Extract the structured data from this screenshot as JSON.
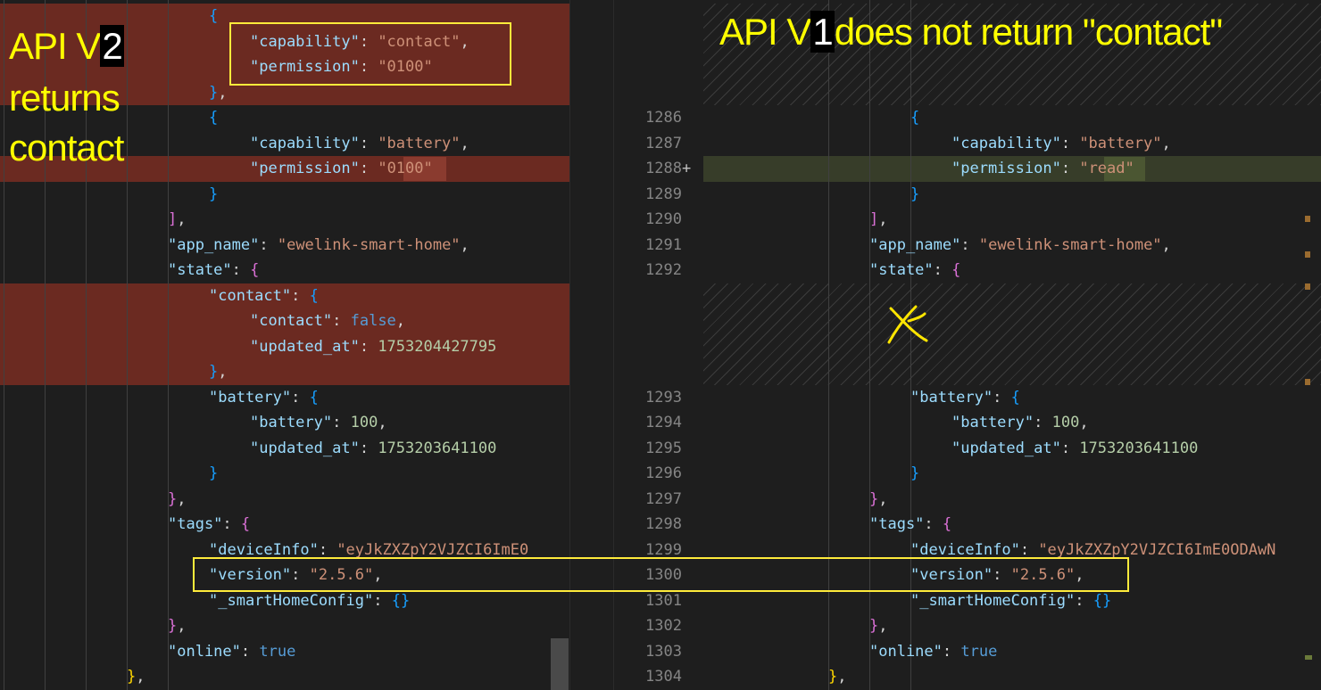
{
  "annotations": {
    "left_title_prefix": "API V",
    "left_title_digit": "2",
    "left_line2": "returns",
    "left_line3": "contact",
    "right_prefix": "API V",
    "right_digit": "1",
    "right_suffix": "does not return \"contact\""
  },
  "left_code": [
    {
      "parts": [
        {
          "t": "{",
          "c": "c"
        }
      ]
    },
    {
      "parts": [
        {
          "t": "\"capability\"",
          "c": "k"
        },
        {
          "t": ": ",
          "c": "p"
        },
        {
          "t": "\"contact\"",
          "c": "s"
        },
        {
          "t": ",",
          "c": "p"
        }
      ]
    },
    {
      "parts": [
        {
          "t": "\"permission\"",
          "c": "k"
        },
        {
          "t": ": ",
          "c": "p"
        },
        {
          "t": "\"0100\"",
          "c": "s"
        }
      ]
    },
    {
      "parts": [
        {
          "t": "}",
          "c": "c"
        },
        {
          "t": ",",
          "c": "p"
        }
      ]
    },
    {
      "parts": [
        {
          "t": "{",
          "c": "c"
        }
      ]
    },
    {
      "parts": [
        {
          "t": "\"capability\"",
          "c": "k"
        },
        {
          "t": ": ",
          "c": "p"
        },
        {
          "t": "\"battery\"",
          "c": "s"
        },
        {
          "t": ",",
          "c": "p"
        }
      ]
    },
    {
      "parts": [
        {
          "t": "\"permission\"",
          "c": "k"
        },
        {
          "t": ": ",
          "c": "p"
        },
        {
          "t": "\"",
          "c": "s"
        },
        {
          "t": "0100",
          "c": "s"
        },
        {
          "t": "\"",
          "c": "s"
        }
      ]
    },
    {
      "parts": [
        {
          "t": "}",
          "c": "c"
        }
      ]
    },
    {
      "parts": [
        {
          "t": "]",
          "c": "m"
        },
        {
          "t": ",",
          "c": "p"
        }
      ]
    },
    {
      "parts": [
        {
          "t": "\"app_name\"",
          "c": "k"
        },
        {
          "t": ": ",
          "c": "p"
        },
        {
          "t": "\"ewelink-smart-home\"",
          "c": "s"
        },
        {
          "t": ",",
          "c": "p"
        }
      ]
    },
    {
      "parts": [
        {
          "t": "\"state\"",
          "c": "k"
        },
        {
          "t": ": ",
          "c": "p"
        },
        {
          "t": "{",
          "c": "m"
        }
      ]
    },
    {
      "parts": [
        {
          "t": "\"contact\"",
          "c": "k"
        },
        {
          "t": ": ",
          "c": "p"
        },
        {
          "t": "{",
          "c": "c"
        }
      ]
    },
    {
      "parts": [
        {
          "t": "\"contact\"",
          "c": "k"
        },
        {
          "t": ": ",
          "c": "p"
        },
        {
          "t": "false",
          "c": "b"
        },
        {
          "t": ",",
          "c": "p"
        }
      ]
    },
    {
      "parts": [
        {
          "t": "\"updated_at\"",
          "c": "k"
        },
        {
          "t": ": ",
          "c": "p"
        },
        {
          "t": "1753204427795",
          "c": "n"
        }
      ]
    },
    {
      "parts": [
        {
          "t": "}",
          "c": "c"
        },
        {
          "t": ",",
          "c": "p"
        }
      ]
    },
    {
      "parts": [
        {
          "t": "\"battery\"",
          "c": "k"
        },
        {
          "t": ": ",
          "c": "p"
        },
        {
          "t": "{",
          "c": "c"
        }
      ]
    },
    {
      "parts": [
        {
          "t": "\"battery\"",
          "c": "k"
        },
        {
          "t": ": ",
          "c": "p"
        },
        {
          "t": "100",
          "c": "n"
        },
        {
          "t": ",",
          "c": "p"
        }
      ]
    },
    {
      "parts": [
        {
          "t": "\"updated_at\"",
          "c": "k"
        },
        {
          "t": ": ",
          "c": "p"
        },
        {
          "t": "1753203641100",
          "c": "n"
        }
      ]
    },
    {
      "parts": [
        {
          "t": "}",
          "c": "c"
        }
      ]
    },
    {
      "parts": [
        {
          "t": "}",
          "c": "m"
        },
        {
          "t": ",",
          "c": "p"
        }
      ]
    },
    {
      "parts": [
        {
          "t": "\"tags\"",
          "c": "k"
        },
        {
          "t": ": ",
          "c": "p"
        },
        {
          "t": "{",
          "c": "m"
        }
      ]
    },
    {
      "parts": [
        {
          "t": "\"deviceInfo\"",
          "c": "k"
        },
        {
          "t": ": ",
          "c": "p"
        },
        {
          "t": "\"eyJkZXZpY2VJZCI6ImE0",
          "c": "s"
        }
      ]
    },
    {
      "parts": [
        {
          "t": "\"version\"",
          "c": "k"
        },
        {
          "t": ": ",
          "c": "p"
        },
        {
          "t": "\"2.5.6\"",
          "c": "s"
        },
        {
          "t": ",",
          "c": "p"
        }
      ]
    },
    {
      "parts": [
        {
          "t": "\"_smartHomeConfig\"",
          "c": "k"
        },
        {
          "t": ": ",
          "c": "p"
        },
        {
          "t": "{}",
          "c": "c"
        }
      ]
    },
    {
      "parts": [
        {
          "t": "}",
          "c": "m"
        },
        {
          "t": ",",
          "c": "p"
        }
      ]
    },
    {
      "parts": [
        {
          "t": "\"online\"",
          "c": "k"
        },
        {
          "t": ": ",
          "c": "p"
        },
        {
          "t": "true",
          "c": "b"
        }
      ]
    },
    {
      "parts": [
        {
          "t": "}",
          "c": "y"
        },
        {
          "t": ",",
          "c": "p"
        }
      ]
    }
  ],
  "right_code": [
    {
      "num": "1286",
      "parts": [
        {
          "t": "{",
          "c": "c"
        }
      ]
    },
    {
      "num": "1287",
      "parts": [
        {
          "t": "\"capability\"",
          "c": "k"
        },
        {
          "t": ": ",
          "c": "p"
        },
        {
          "t": "\"battery\"",
          "c": "s"
        },
        {
          "t": ",",
          "c": "p"
        }
      ]
    },
    {
      "num": "1288",
      "plus": "+",
      "parts": [
        {
          "t": "\"permission\"",
          "c": "k"
        },
        {
          "t": ": ",
          "c": "p"
        },
        {
          "t": "\"",
          "c": "s"
        },
        {
          "t": "read",
          "c": "s"
        },
        {
          "t": "\"",
          "c": "s"
        }
      ]
    },
    {
      "num": "1289",
      "parts": [
        {
          "t": "}",
          "c": "c"
        }
      ]
    },
    {
      "num": "1290",
      "parts": [
        {
          "t": "]",
          "c": "m"
        },
        {
          "t": ",",
          "c": "p"
        }
      ]
    },
    {
      "num": "1291",
      "parts": [
        {
          "t": "\"app_name\"",
          "c": "k"
        },
        {
          "t": ": ",
          "c": "p"
        },
        {
          "t": "\"ewelink-smart-home\"",
          "c": "s"
        },
        {
          "t": ",",
          "c": "p"
        }
      ]
    },
    {
      "num": "1292",
      "parts": [
        {
          "t": "\"state\"",
          "c": "k"
        },
        {
          "t": ": ",
          "c": "p"
        },
        {
          "t": "{",
          "c": "m"
        }
      ]
    },
    {
      "num": "1293",
      "parts": [
        {
          "t": "\"battery\"",
          "c": "k"
        },
        {
          "t": ": ",
          "c": "p"
        },
        {
          "t": "{",
          "c": "c"
        }
      ]
    },
    {
      "num": "1294",
      "parts": [
        {
          "t": "\"battery\"",
          "c": "k"
        },
        {
          "t": ": ",
          "c": "p"
        },
        {
          "t": "100",
          "c": "n"
        },
        {
          "t": ",",
          "c": "p"
        }
      ]
    },
    {
      "num": "1295",
      "parts": [
        {
          "t": "\"updated_at\"",
          "c": "k"
        },
        {
          "t": ": ",
          "c": "p"
        },
        {
          "t": "1753203641100",
          "c": "n"
        }
      ]
    },
    {
      "num": "1296",
      "parts": [
        {
          "t": "}",
          "c": "c"
        }
      ]
    },
    {
      "num": "1297",
      "parts": [
        {
          "t": "}",
          "c": "m"
        },
        {
          "t": ",",
          "c": "p"
        }
      ]
    },
    {
      "num": "1298",
      "parts": [
        {
          "t": "\"tags\"",
          "c": "k"
        },
        {
          "t": ": ",
          "c": "p"
        },
        {
          "t": "{",
          "c": "m"
        }
      ]
    },
    {
      "num": "1299",
      "parts": [
        {
          "t": "\"deviceInfo\"",
          "c": "k"
        },
        {
          "t": ": ",
          "c": "p"
        },
        {
          "t": "\"eyJkZXZpY2VJZCI6ImE0ODAwN",
          "c": "s"
        }
      ]
    },
    {
      "num": "1300",
      "parts": [
        {
          "t": "\"version\"",
          "c": "k"
        },
        {
          "t": ": ",
          "c": "p"
        },
        {
          "t": "\"2.5.6\"",
          "c": "s"
        },
        {
          "t": ",",
          "c": "p"
        }
      ]
    },
    {
      "num": "1301",
      "parts": [
        {
          "t": "\"_smartHomeConfig\"",
          "c": "k"
        },
        {
          "t": ": ",
          "c": "p"
        },
        {
          "t": "{}",
          "c": "c"
        }
      ]
    },
    {
      "num": "1302",
      "parts": [
        {
          "t": "}",
          "c": "m"
        },
        {
          "t": ",",
          "c": "p"
        }
      ]
    },
    {
      "num": "1303",
      "parts": [
        {
          "t": "\"online\"",
          "c": "k"
        },
        {
          "t": ": ",
          "c": "p"
        },
        {
          "t": "true",
          "c": "b"
        }
      ]
    },
    {
      "num": "1304",
      "parts": [
        {
          "t": "}",
          "c": "y"
        },
        {
          "t": ",",
          "c": "p"
        }
      ]
    }
  ],
  "colors": {
    "removed_band": "#6b2a21",
    "added_band": "#373d29",
    "annotation": "#ffff00"
  }
}
